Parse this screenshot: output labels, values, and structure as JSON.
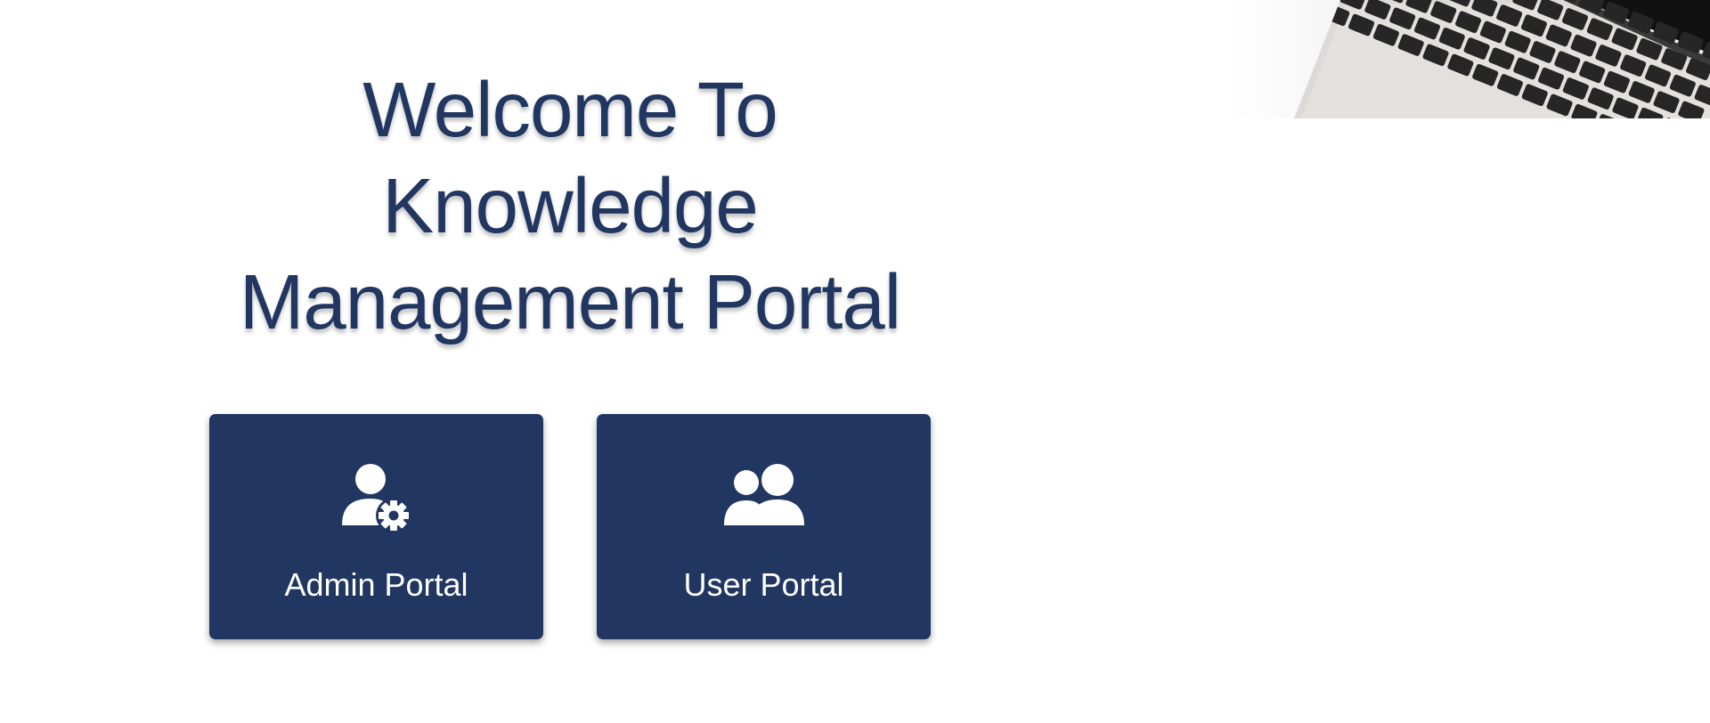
{
  "hero": {
    "title_lines": [
      "Welcome To",
      "Knowledge",
      "Management Portal"
    ]
  },
  "portals": {
    "admin": {
      "label": "Admin Portal",
      "icon": "user-gear-icon"
    },
    "user": {
      "label": "User Portal",
      "icon": "users-icon"
    }
  },
  "decor": {
    "image": "laptop-keyboard-image"
  },
  "colors": {
    "primary": "#213660",
    "card_text": "#ffffff",
    "background": "#ffffff"
  }
}
